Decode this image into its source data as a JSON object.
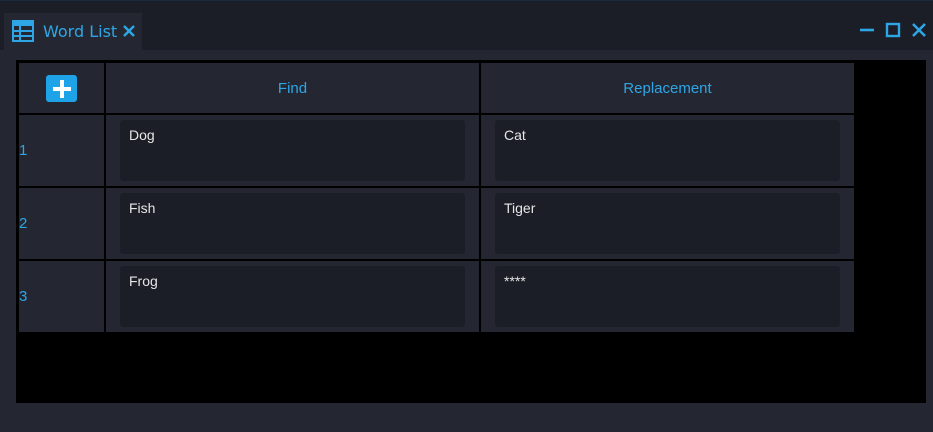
{
  "window": {
    "tab_title": "Word List",
    "tab_icon": "table-icon",
    "tab_close_icon": "close-icon",
    "controls": [
      "minimize-icon",
      "maximize-icon",
      "close-icon"
    ],
    "accent_color": "#2ea6e6"
  },
  "table": {
    "add_button_icon": "plus-icon",
    "columns": [
      "Find",
      "Replacement"
    ],
    "rows": [
      {
        "index": "1",
        "find": "Dog",
        "replacement": "Cat"
      },
      {
        "index": "2",
        "find": "Fish",
        "replacement": "Tiger"
      },
      {
        "index": "3",
        "find": "Frog",
        "replacement": "****"
      }
    ]
  }
}
